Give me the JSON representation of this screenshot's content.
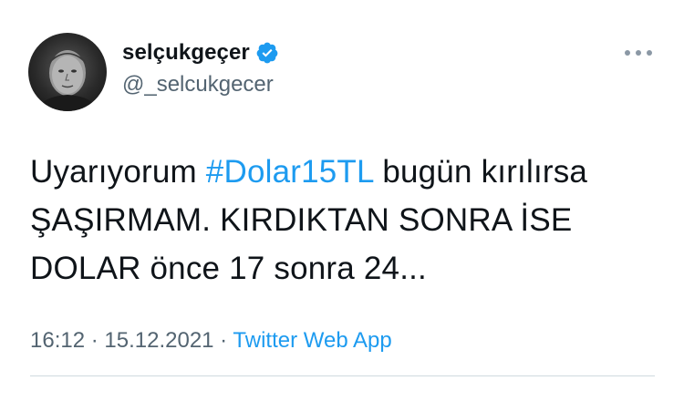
{
  "author": {
    "display_name": "selçukgeçer",
    "handle": "@_selcukgecer",
    "verified_icon": "verified-badge-icon",
    "avatar": "profile-photo"
  },
  "tweet": {
    "text_before": "Uyarıyorum  ",
    "hashtag": "#Dolar15TL",
    "text_after": " bugün kırılırsa ŞAŞIRMAM. KIRDIKTAN SONRA İSE DOLAR önce 17 sonra 24..."
  },
  "meta": {
    "time": "16:12",
    "separator": " · ",
    "date": "15.12.2021",
    "separator2": " · ",
    "source": "Twitter Web App"
  },
  "colors": {
    "accent": "#1d9bf0",
    "text": "#0f1419",
    "muted": "#536471"
  }
}
